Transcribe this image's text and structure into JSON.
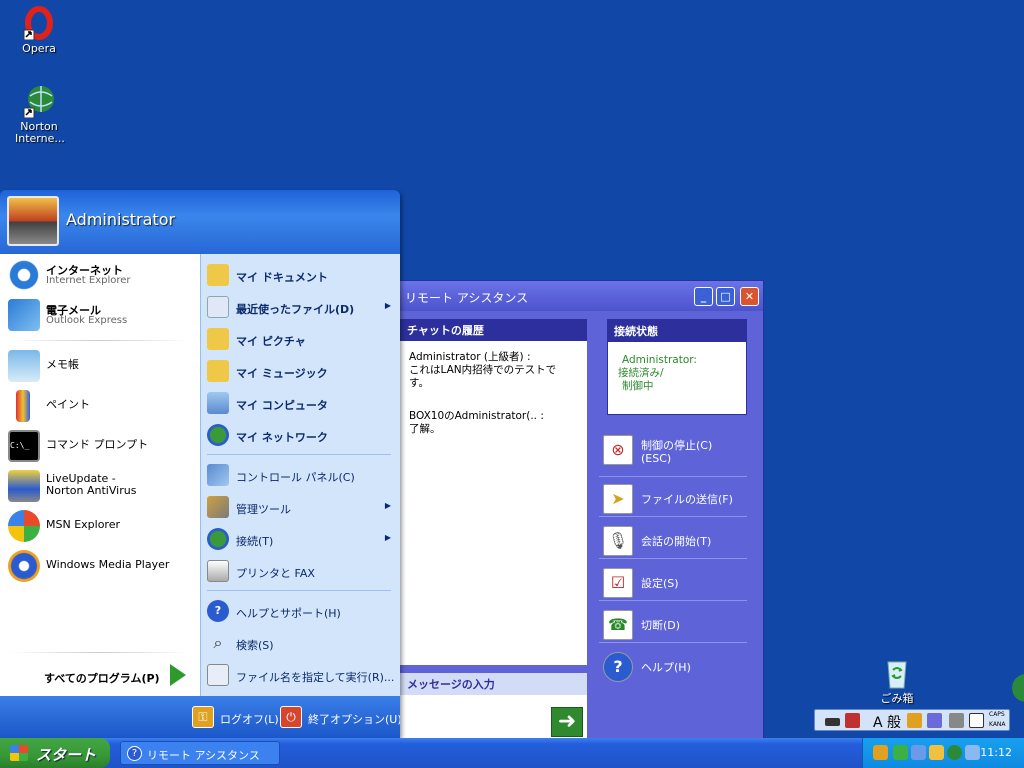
{
  "desktop": {
    "icons": [
      {
        "label": "Opera",
        "icon": "opera-icon"
      },
      {
        "label": "Norton Interne...",
        "icon": "norton-internet-security-icon"
      },
      {
        "label": "ごみ箱",
        "icon": "recycle-bin-icon"
      }
    ]
  },
  "remote_assistance": {
    "title": "リモート アシスタンス",
    "chat_history_header": "チャットの履歴",
    "chat_lines": [
      "Administrator (上級者) :",
      "これはLAN内招待でのテストです。",
      "BOX10のAdministrator(.. :",
      "了解。"
    ],
    "message_input_header": "メッセージの入力",
    "send_glyph": "➜",
    "connection_header": "接続状態",
    "connection_lines": [
      "Administrator:",
      "接続済み/",
      "制御中"
    ],
    "actions": [
      {
        "label": "制御の停止(C)",
        "label2": "(ESC)",
        "icon": "stop-control-icon"
      },
      {
        "label": "ファイルの送信(F)",
        "icon": "send-file-icon"
      },
      {
        "label": "会話の開始(T)",
        "icon": "microphone-icon"
      },
      {
        "label": "設定(S)",
        "icon": "settings-icon"
      },
      {
        "label": "切断(D)",
        "icon": "disconnect-icon"
      },
      {
        "label": "ヘルプ(H)",
        "icon": "help-icon"
      }
    ],
    "minimize_glyph": "_",
    "maximize_glyph": "□",
    "close_glyph": "✕"
  },
  "start_menu": {
    "user_name": "Administrator",
    "pinned": [
      {
        "title": "インターネット",
        "subtitle": "Internet Explorer",
        "icon": "internet-explorer-icon"
      },
      {
        "title": "電子メール",
        "subtitle": "Outlook Express",
        "icon": "outlook-express-icon"
      }
    ],
    "recent": [
      {
        "label": "メモ帳",
        "icon": "notepad-icon"
      },
      {
        "label": "ペイント",
        "icon": "paint-icon"
      },
      {
        "label": "コマンド プロンプト",
        "icon": "command-prompt-icon"
      },
      {
        "label": "LiveUpdate - Norton AntiVirus",
        "icon": "liveupdate-icon"
      },
      {
        "label": "MSN Explorer",
        "icon": "msn-explorer-icon"
      },
      {
        "label": "Windows Media Player",
        "icon": "windows-media-player-icon"
      }
    ],
    "all_programs": "すべてのプログラム(P)",
    "places": [
      {
        "label": "マイ ドキュメント",
        "icon": "my-documents-icon",
        "bold": true,
        "submenu": false
      },
      {
        "label": "最近使ったファイル(D)",
        "icon": "recent-documents-icon",
        "bold": true,
        "submenu": true
      },
      {
        "label": "マイ ピクチャ",
        "icon": "my-pictures-icon",
        "bold": true,
        "submenu": false
      },
      {
        "label": "マイ ミュージック",
        "icon": "my-music-icon",
        "bold": true,
        "submenu": false
      },
      {
        "label": "マイ コンピュータ",
        "icon": "my-computer-icon",
        "bold": true,
        "submenu": false
      },
      {
        "label": "マイ ネットワーク",
        "icon": "my-network-icon",
        "bold": true,
        "submenu": false
      }
    ],
    "system": [
      {
        "label": "コントロール パネル(C)",
        "icon": "control-panel-icon",
        "submenu": false
      },
      {
        "label": "管理ツール",
        "icon": "admin-tools-icon",
        "submenu": true
      },
      {
        "label": "接続(T)",
        "icon": "connections-icon",
        "submenu": true
      },
      {
        "label": "プリンタと FAX",
        "icon": "printer-icon",
        "submenu": false
      }
    ],
    "support": [
      {
        "label": "ヘルプとサポート(H)",
        "icon": "help-support-icon"
      },
      {
        "label": "検索(S)",
        "icon": "search-icon"
      },
      {
        "label": "ファイル名を指定して実行(R)...",
        "icon": "run-icon"
      }
    ],
    "logoff": "ログオフ(L)",
    "shutdown": "終了オプション(U)",
    "submenu_arrow": "▶"
  },
  "taskbar": {
    "start_label": "スタート",
    "window_button": "リモート アシスタンス",
    "clock": "11:12"
  },
  "language_bar": {
    "mode_text": "A 般",
    "caps": "CAPS",
    "kana": "KANA"
  },
  "colors": {
    "desktop": "#1148a8",
    "start_green": "#379837",
    "ra_panel": "#5e64d8"
  }
}
